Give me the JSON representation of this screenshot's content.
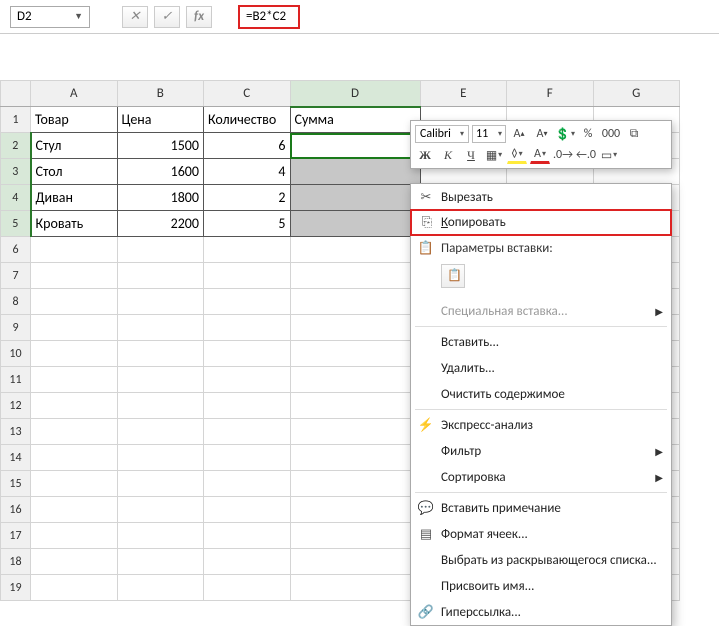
{
  "formula_bar": {
    "name_box": "D2",
    "formula": "=B2*C2"
  },
  "columns": [
    "A",
    "B",
    "C",
    "D",
    "E",
    "F",
    "G"
  ],
  "header": {
    "product": "Товар",
    "price": "Цена",
    "qty": "Количество",
    "sum": "Сумма"
  },
  "rows": [
    {
      "product": "Стул",
      "price": "1500",
      "qty": "6"
    },
    {
      "product": "Стол",
      "price": "1600",
      "qty": "4"
    },
    {
      "product": "Диван",
      "price": "1800",
      "qty": "2"
    },
    {
      "product": "Кровать",
      "price": "2200",
      "qty": "5"
    }
  ],
  "mini": {
    "font": "Calibri",
    "size": "11"
  },
  "menu": {
    "cut": "Вырезать",
    "copy": "Копировать",
    "paste_opts": "Параметры вставки:",
    "paste_special": "Специальная вставка...",
    "insert": "Вставить...",
    "delete": "Удалить...",
    "clear": "Очистить содержимое",
    "quick": "Экспресс-анализ",
    "filter": "Фильтр",
    "sort": "Сортировка",
    "comment": "Вставить примечание",
    "format": "Формат ячеек...",
    "dropdown": "Выбрать из раскрывающегося списка...",
    "name": "Присвоить имя...",
    "link": "Гиперссылка..."
  }
}
